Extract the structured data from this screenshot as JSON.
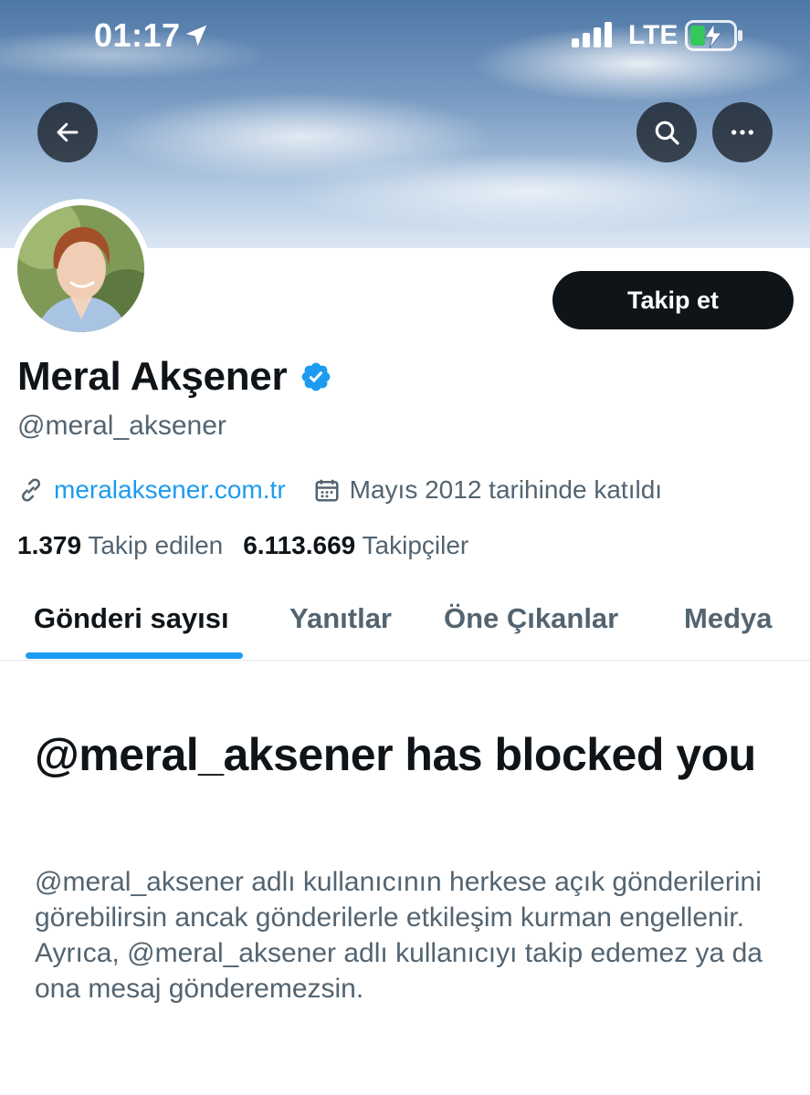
{
  "status_bar": {
    "time": "01:17",
    "network": "LTE",
    "icons": [
      "location-arrow-icon",
      "signal-bars-icon",
      "battery-charging-icon"
    ]
  },
  "header": {
    "buttons": [
      "back-arrow-icon",
      "search-icon",
      "more-dots-icon"
    ]
  },
  "profile": {
    "name": "Meral Akşener",
    "handle": "@meral_aksener",
    "verified": true,
    "website": "meralaksener.com.tr",
    "joined": "Mayıs 2012 tarihinde katıldı",
    "follow_label": "Takip et"
  },
  "stats": {
    "following_count": "1.379",
    "following_label": "Takip edilen",
    "followers_count": "6.113.669",
    "followers_label": "Takipçiler"
  },
  "tabs": [
    {
      "label": "Gönderi sayısı",
      "active": true
    },
    {
      "label": "Yanıtlar",
      "active": false
    },
    {
      "label": "Öne Çıkanlar",
      "active": false
    },
    {
      "label": "Medya",
      "active": false
    }
  ],
  "blocked": {
    "title": "@meral_aksener has blocked you",
    "description": "@meral_aksener adlı kullanıcının herkese açık gönderilerini görebilirsin ancak gönderilerle etkileşim kurman engellenir. Ayrıca, @meral_aksener adlı kullanıcıyı takip edemez ya da ona mesaj gönderemezsin."
  },
  "colors": {
    "accent": "#1d9bf0",
    "text_primary": "#0f1419",
    "text_secondary": "#536471",
    "button_dark": "#0f1419"
  }
}
